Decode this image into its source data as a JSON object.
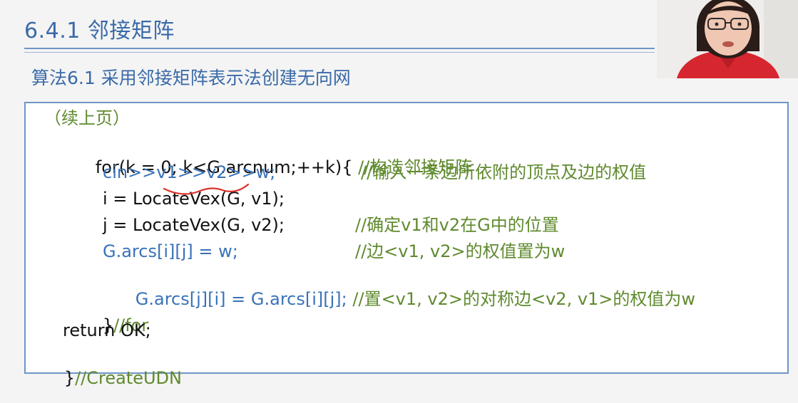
{
  "section": {
    "title": "6.4.1 邻接矩阵"
  },
  "algorithm": {
    "title": "算法6.1 采用邻接矩阵表示法创建无向网"
  },
  "code": {
    "continued": "（续上页）",
    "for_head": "for(k = 0; k<G.arcnum;++k){ ",
    "for_comment": "//构造邻接矩阵",
    "cin_line": "cin>>v1>>v2>>w;",
    "cin_comment": "//输入一条边所依附的顶点及边的权值",
    "i_line": "i = LocateVex(G, v1);",
    "j_line": "j = LocateVex(G, v2);",
    "j_comment": "//确定v1和v2在G中的位置",
    "arc1_line": "G.arcs[i][j] = w;",
    "arc1_comment": "//边<v1, v2>的权值置为w",
    "arc2_line": "G.arcs[j][i] = G.arcs[i][j];",
    "arc2_comment": " //置<v1, v2>的对称边<v2, v1>的权值为w",
    "for_close_brace": "}",
    "for_close_comment": "//for",
    "return_line": "return OK;",
    "end_brace": "}",
    "end_comment": "//CreateUDN"
  },
  "colors": {
    "heading": "#3a6aa8",
    "code_blue": "#3a72b8",
    "comment_green": "#5f8a2e",
    "annotation_red": "#d9342b"
  }
}
